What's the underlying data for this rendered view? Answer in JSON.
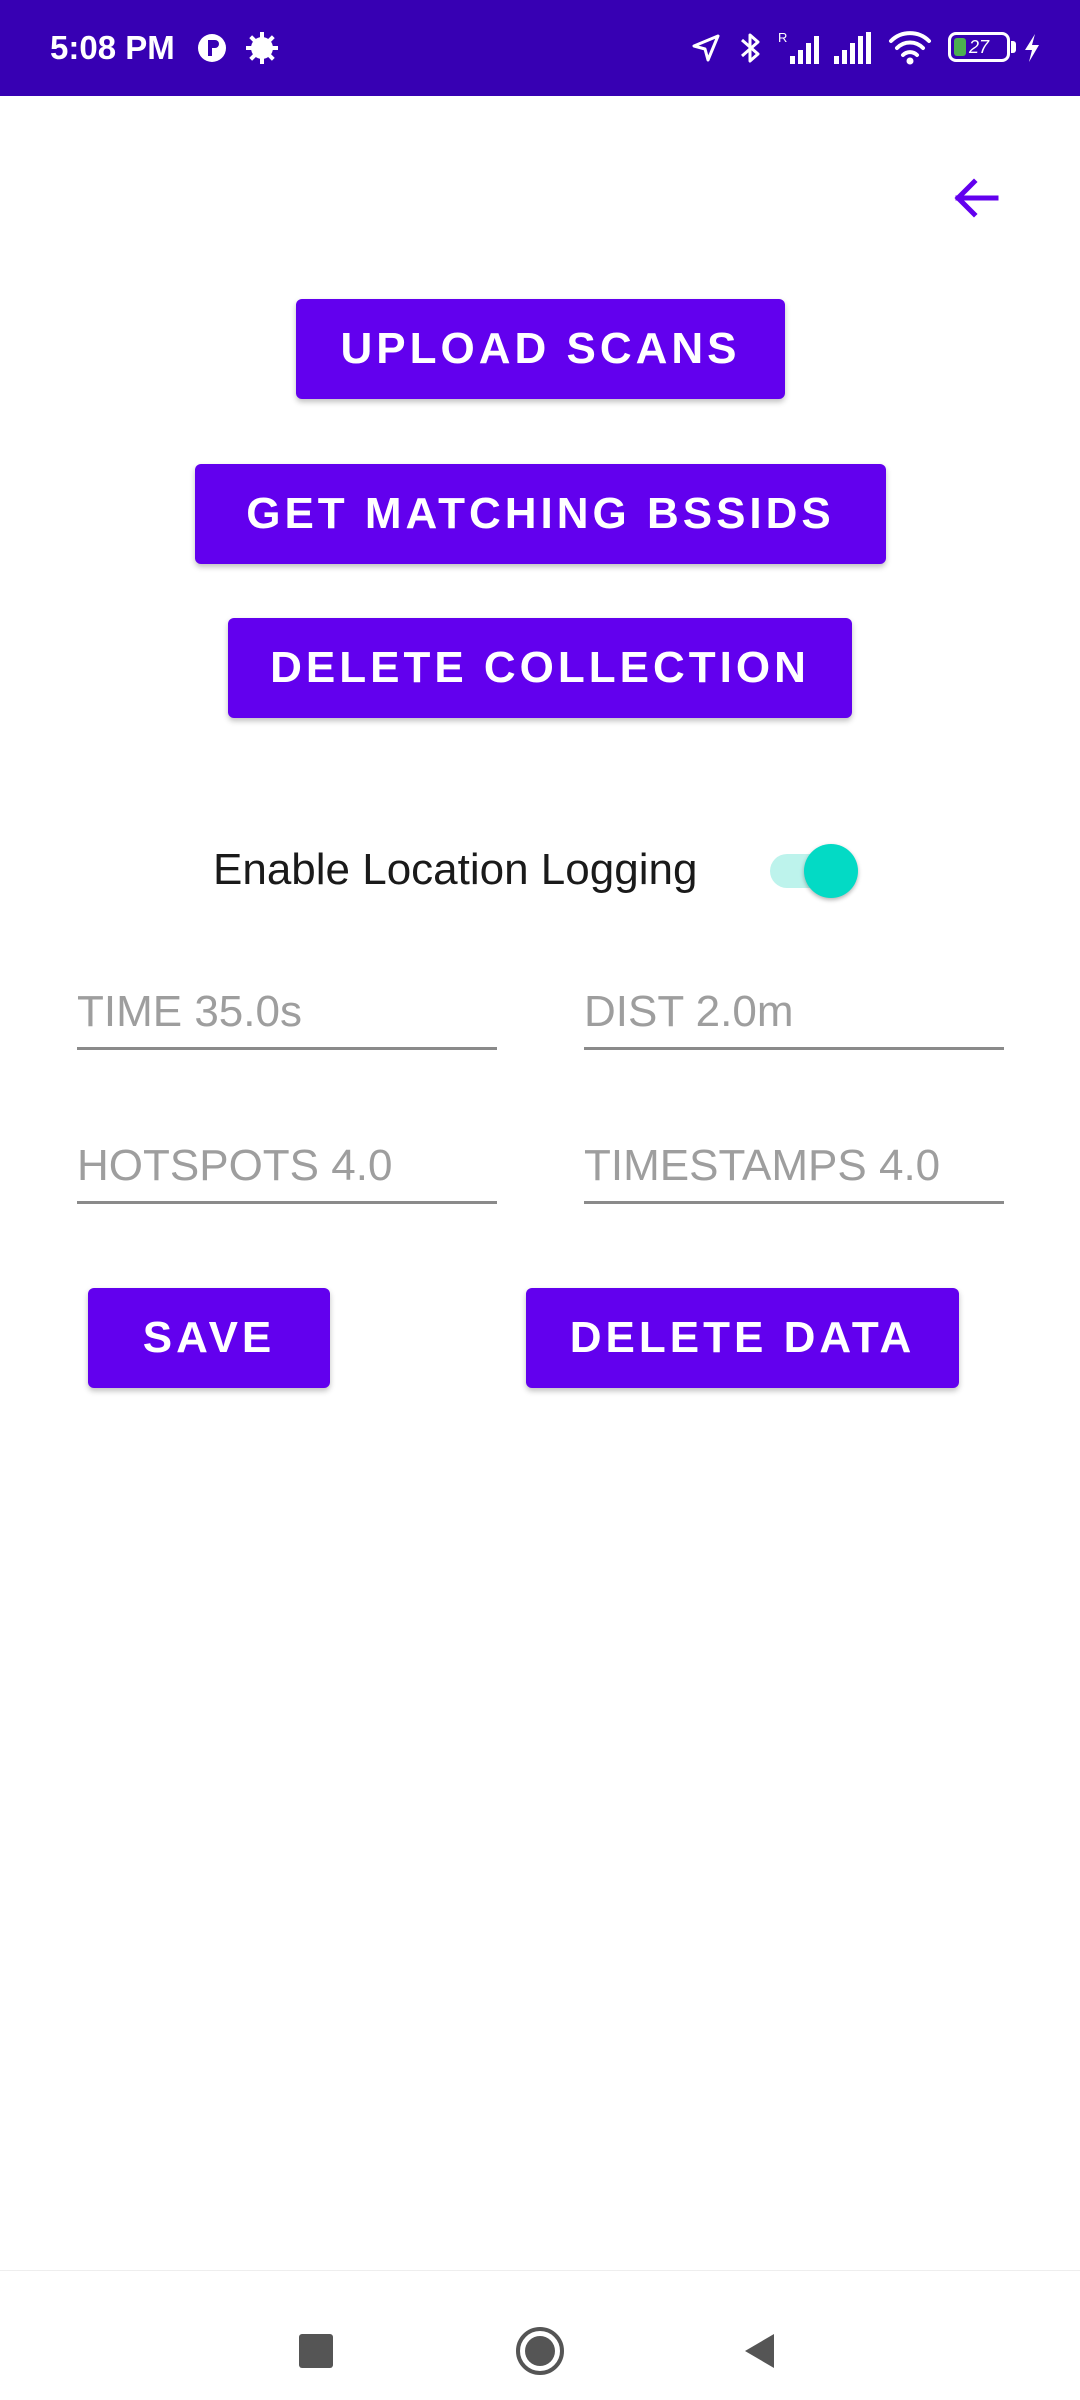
{
  "status_bar": {
    "time": "5:08 PM",
    "battery_level": "27",
    "icons": [
      "vpn-key-icon",
      "settings-gear-icon",
      "location-arrow-icon",
      "bluetooth-icon",
      "signal-roaming-icon",
      "signal-icon",
      "wifi-icon",
      "battery-icon",
      "charging-bolt-icon"
    ],
    "background_color": "#3700b3"
  },
  "toolbar": {
    "back_icon": "arrow-back-icon",
    "accent_color": "#6200ee"
  },
  "actions": {
    "upload_scans": "UPLOAD SCANS",
    "get_matching_bssids": "GET MATCHING BSSIDS",
    "delete_collection": "DELETE COLLECTION"
  },
  "location_logging": {
    "label": "Enable Location Logging",
    "enabled": true,
    "thumb_color": "#03dac5"
  },
  "fields": {
    "time_placeholder": "TIME 35.0s",
    "dist_placeholder": "DIST 2.0m",
    "hotspots_placeholder": "HOTSPOTS 4.0",
    "timestamps_placeholder": "TIMESTAMPS 4.0"
  },
  "bottom_actions": {
    "save": "SAVE",
    "delete_data": "DELETE DATA"
  },
  "nav_bar": {
    "icons": [
      "recents-square-icon",
      "home-circle-icon",
      "back-triangle-icon"
    ]
  }
}
